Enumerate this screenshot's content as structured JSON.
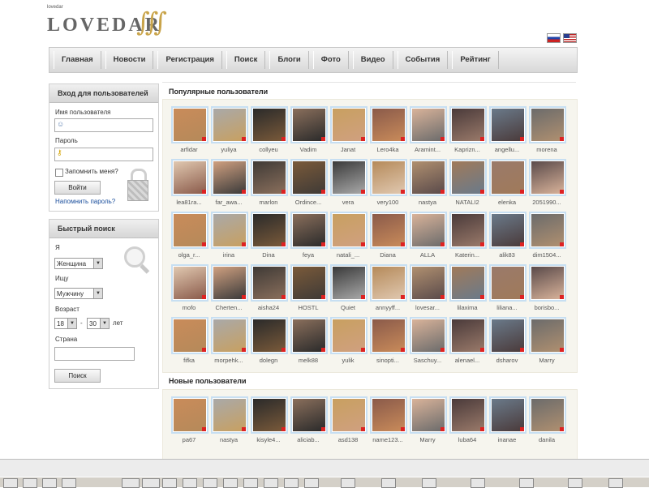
{
  "logo": {
    "small": "lovedar",
    "text": "LOVEDAR"
  },
  "flags": [
    "ru-flag-icon",
    "us-flag-icon"
  ],
  "nav": [
    "Главная",
    "Новости",
    "Регистрация",
    "Поиск",
    "Блоги",
    "Фото",
    "Видео",
    "События",
    "Рейтинг"
  ],
  "login": {
    "title": "Вход для пользователей",
    "username_label": "Имя пользователя",
    "password_label": "Пароль",
    "remember_label": "Запомнить меня?",
    "login_button": "Войти",
    "forgot_link": "Напомнить пароль?"
  },
  "search": {
    "title": "Быстрый поиск",
    "i_label": "Я",
    "i_value": "Женщина",
    "seek_label": "Ищу",
    "seek_value": "Мужчину",
    "age_label": "Возраст",
    "age_from": "18",
    "age_sep": "-",
    "age_to": "30",
    "age_unit": "лет",
    "country_label": "Страна",
    "search_button": "Поиск"
  },
  "popular": {
    "title": "Популярные пользователи",
    "users": [
      "arfidar",
      "yuliya",
      "collyeu",
      "Vadim",
      "Janat",
      "Lero4ka",
      "Aramint...",
      "Kaprizn...",
      "angellu...",
      "morena",
      "lea81ra...",
      "far_awa...",
      "marlon",
      "Ordince...",
      "vera",
      "very100",
      "nastya",
      "NATALI2",
      "elenka",
      "2051990...",
      "olga_r...",
      "irina",
      "Dina",
      "feya",
      "natali_...",
      "Diana",
      "ALLA",
      "Katerin...",
      "alik83",
      "dim1504...",
      "mofo",
      "Cherten...",
      "aisha24",
      "HOSTL",
      "Quiet",
      "annyyff...",
      "lovesar...",
      "lilaxima",
      "liliana...",
      "borisbo...",
      "fifka",
      "morpehk...",
      "dolegn",
      "melk88",
      "yulik",
      "sinopti...",
      "Saschuy...",
      "alenael...",
      "dsharov",
      "Marry"
    ]
  },
  "new_users": {
    "title": "Новые пользователи",
    "users": [
      "pa67",
      "nastya",
      "kisyle4...",
      "aliciab...",
      "asd138",
      "name123...",
      "Marry",
      "luba64",
      "inanae",
      "danila"
    ]
  },
  "colors": {
    "thumb_border": "#c7dff2",
    "grid_bg": "#f6f5ee",
    "link": "#1a4e9c"
  }
}
